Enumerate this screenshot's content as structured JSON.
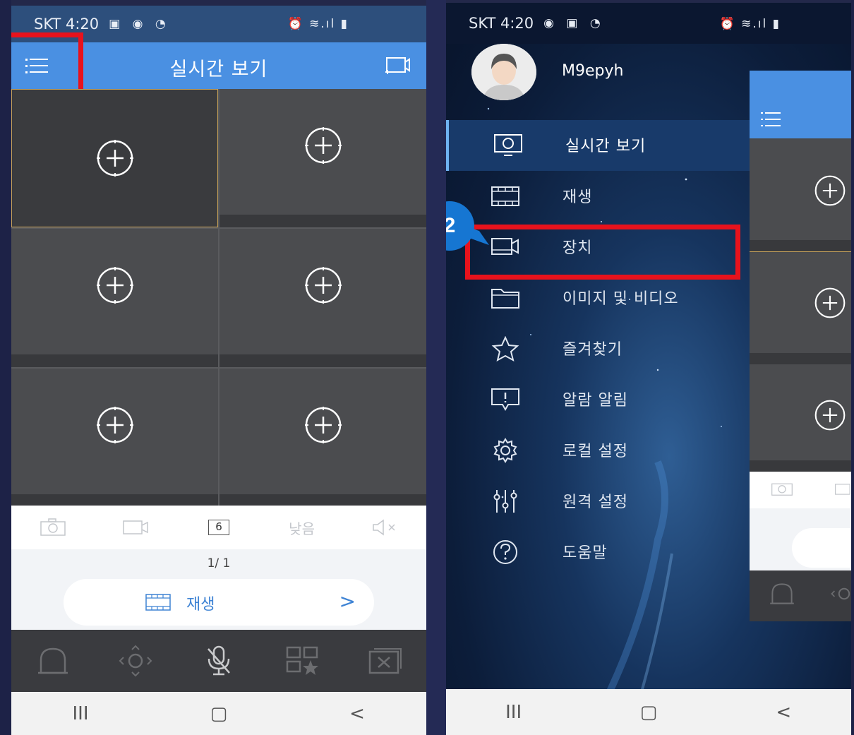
{
  "left_screen": {
    "status": {
      "carrier_time": "SKT 4:20",
      "icons_left": "▣ ◉ ◔",
      "icons_right": "⏰ ≋.ıl ▮"
    },
    "header": {
      "title": "실시간 보기",
      "menu_icon": "hamburger-menu-icon",
      "cast_icon": "cast-screen-icon"
    },
    "grid": {
      "cells": 6,
      "add_icon": "add-circle-icon"
    },
    "toolbar": {
      "split_count": "6",
      "quality": "낮음"
    },
    "paging": {
      "page": "1/ 1",
      "playback_label": "재생"
    },
    "nav": {
      "recent": "III",
      "home": "▢",
      "back": "<"
    }
  },
  "right_screen": {
    "status": {
      "carrier_time": "SKT 4:20",
      "icons_left": "◉ ▣ ◔",
      "icons_right": "⏰ ≋.ıl ▮"
    },
    "user": {
      "name": "M9epyh"
    },
    "drawer": [
      {
        "label": "실시간 보기",
        "icon": "monitor-icon",
        "active": true
      },
      {
        "label": "재생",
        "icon": "film-icon"
      },
      {
        "label": "장치",
        "icon": "camera-device-icon"
      },
      {
        "label": "이미지 및 비디오",
        "icon": "folder-icon"
      },
      {
        "label": "즐겨찾기",
        "icon": "star-icon"
      },
      {
        "label": "알람 알림",
        "icon": "alarm-message-icon"
      },
      {
        "label": "로컬 설정",
        "icon": "gear-icon"
      },
      {
        "label": "원격 설정",
        "icon": "sliders-icon"
      },
      {
        "label": "도움말",
        "icon": "help-icon"
      }
    ],
    "step_badge": "2",
    "nav": {
      "recent": "III",
      "home": "▢",
      "back": "<"
    }
  },
  "colors": {
    "highlight": "#e8121c",
    "header_blue": "#4a90e2",
    "badge_blue": "#1676d2"
  }
}
